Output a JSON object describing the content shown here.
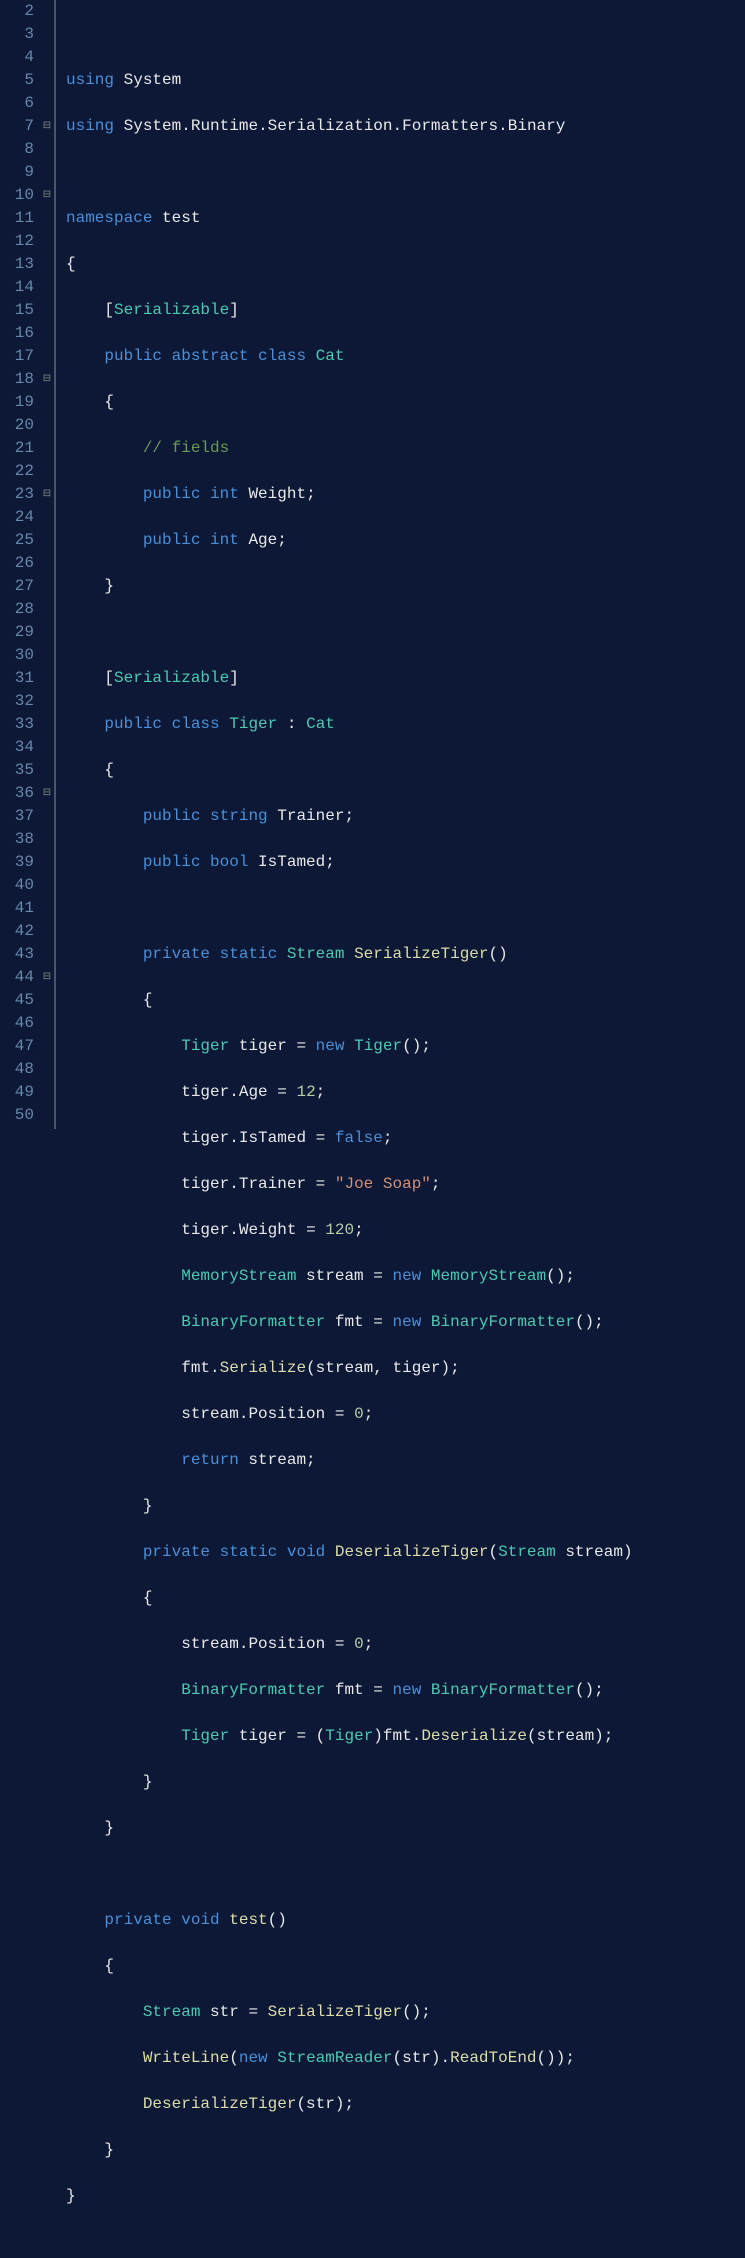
{
  "lines": {
    "start": 2,
    "end": 50
  },
  "code": {
    "l3": {
      "kw1": "using",
      "ident1": " System"
    },
    "l4": {
      "kw1": "using",
      "ident1": " System",
      "p1": ".",
      "ident2": "Runtime",
      "p2": ".",
      "ident3": "Serialization",
      "p3": ".",
      "ident4": "Formatters",
      "p4": ".",
      "ident5": "Binary"
    },
    "l6": {
      "kw1": "namespace",
      "ident1": " test"
    },
    "l7": {
      "p1": "{"
    },
    "l8": {
      "p1": "    [",
      "type1": "Serializable",
      "p2": "]"
    },
    "l9": {
      "pre": "    ",
      "kw1": "public",
      "sp1": " ",
      "kw2": "abstract",
      "sp2": " ",
      "kw3": "class",
      "sp3": " ",
      "type1": "Cat"
    },
    "l10": {
      "p1": "    {"
    },
    "l11": {
      "cmt1": "        // fields"
    },
    "l12": {
      "pre": "        ",
      "kw1": "public",
      "sp1": " ",
      "kw2": "int",
      "ident1": " Weight",
      "p1": ";"
    },
    "l13": {
      "pre": "        ",
      "kw1": "public",
      "sp1": " ",
      "kw2": "int",
      "ident1": " Age",
      "p1": ";"
    },
    "l14": {
      "p1": "    }"
    },
    "l16": {
      "p1": "    [",
      "type1": "Serializable",
      "p2": "]"
    },
    "l17": {
      "pre": "    ",
      "kw1": "public",
      "sp1": " ",
      "kw2": "class",
      "sp2": " ",
      "type1": "Tiger",
      "sp3": " ",
      "p1": ":",
      "sp4": " ",
      "type2": "Cat"
    },
    "l18": {
      "p1": "    {"
    },
    "l19": {
      "pre": "        ",
      "kw1": "public",
      "sp1": " ",
      "kw2": "string",
      "ident1": " Trainer",
      "p1": ";"
    },
    "l20": {
      "pre": "        ",
      "kw1": "public",
      "sp1": " ",
      "kw2": "bool",
      "ident1": " IsTamed",
      "p1": ";"
    },
    "l22": {
      "pre": "        ",
      "kw1": "private",
      "sp1": " ",
      "kw2": "static",
      "sp2": " ",
      "type1": "Stream",
      "sp3": " ",
      "method1": "SerializeTiger",
      "p1": "()"
    },
    "l23": {
      "p1": "        {"
    },
    "l24": {
      "pre": "            ",
      "type1": "Tiger",
      "ident1": " tiger ",
      "p1": "=",
      "sp1": " ",
      "kw1": "new",
      "sp2": " ",
      "type2": "Tiger",
      "p2": "();"
    },
    "l25": {
      "pre": "            ",
      "ident1": "tiger",
      "p1": ".",
      "ident2": "Age ",
      "p2": "=",
      "sp1": " ",
      "num1": "12",
      "p3": ";"
    },
    "l26": {
      "pre": "            ",
      "ident1": "tiger",
      "p1": ".",
      "ident2": "IsTamed ",
      "p2": "=",
      "sp1": " ",
      "bool1": "false",
      "p3": ";"
    },
    "l27": {
      "pre": "            ",
      "ident1": "tiger",
      "p1": ".",
      "ident2": "Trainer ",
      "p2": "=",
      "sp1": " ",
      "str1": "\"Joe Soap\"",
      "p3": ";"
    },
    "l28": {
      "pre": "            ",
      "ident1": "tiger",
      "p1": ".",
      "ident2": "Weight ",
      "p2": "=",
      "sp1": " ",
      "num1": "120",
      "p3": ";"
    },
    "l29": {
      "pre": "            ",
      "type1": "MemoryStream",
      "ident1": " stream ",
      "p1": "=",
      "sp1": " ",
      "kw1": "new",
      "sp2": " ",
      "type2": "MemoryStream",
      "p2": "();"
    },
    "l30": {
      "pre": "            ",
      "type1": "BinaryFormatter",
      "ident1": " fmt ",
      "p1": "=",
      "sp1": " ",
      "kw1": "new",
      "sp2": " ",
      "type2": "BinaryFormatter",
      "p2": "();"
    },
    "l31": {
      "pre": "            ",
      "ident1": "fmt",
      "p1": ".",
      "method1": "Serialize",
      "p2": "(",
      "ident2": "stream",
      "p3": ", ",
      "ident3": "tiger",
      "p4": ");"
    },
    "l32": {
      "pre": "            ",
      "ident1": "stream",
      "p1": ".",
      "ident2": "Position ",
      "p2": "=",
      "sp1": " ",
      "num1": "0",
      "p3": ";"
    },
    "l33": {
      "pre": "            ",
      "kw1": "return",
      "ident1": " stream",
      "p1": ";"
    },
    "l34": {
      "p1": "        }"
    },
    "l35": {
      "pre": "        ",
      "kw1": "private",
      "sp1": " ",
      "kw2": "static",
      "sp2": " ",
      "kw3": "void",
      "sp3": " ",
      "method1": "DeserializeTiger",
      "p1": "(",
      "type1": "Stream",
      "ident1": " stream",
      "p2": ")"
    },
    "l36": {
      "p1": "        {"
    },
    "l37": {
      "pre": "            ",
      "ident1": "stream",
      "p1": ".",
      "ident2": "Position ",
      "p2": "=",
      "sp1": " ",
      "num1": "0",
      "p3": ";"
    },
    "l38": {
      "pre": "            ",
      "type1": "BinaryFormatter",
      "ident1": " fmt ",
      "p1": "=",
      "sp1": " ",
      "kw1": "new",
      "sp2": " ",
      "type2": "BinaryFormatter",
      "p2": "();"
    },
    "l39": {
      "pre": "            ",
      "type1": "Tiger",
      "ident1": " tiger ",
      "p1": "=",
      "sp1": " ",
      "p2": "(",
      "type2": "Tiger",
      "p3": ")",
      "ident2": "fmt",
      "p4": ".",
      "method1": "Deserialize",
      "p5": "(",
      "ident3": "stream",
      "p6": ");"
    },
    "l40": {
      "p1": "        }"
    },
    "l41": {
      "p1": "    }"
    },
    "l43": {
      "pre": "    ",
      "kw1": "private",
      "sp1": " ",
      "kw2": "void",
      "sp2": " ",
      "method1": "test",
      "p1": "()"
    },
    "l44": {
      "p1": "    {"
    },
    "l45": {
      "pre": "        ",
      "type1": "Stream",
      "ident1": " str ",
      "p1": "=",
      "sp1": " ",
      "method1": "SerializeTiger",
      "p2": "();"
    },
    "l46": {
      "pre": "        ",
      "method1": "WriteLine",
      "p1": "(",
      "kw1": "new",
      "sp1": " ",
      "type1": "StreamReader",
      "p2": "(",
      "ident1": "str",
      "p3": ").",
      "method2": "ReadToEnd",
      "p4": "());"
    },
    "l47": {
      "pre": "        ",
      "method1": "DeserializeTiger",
      "p1": "(",
      "ident1": "str",
      "p2": ");"
    },
    "l48": {
      "p1": "    }"
    },
    "l49": {
      "p1": "}"
    }
  },
  "fold_markers": [
    7,
    10,
    18,
    23,
    36,
    44
  ]
}
